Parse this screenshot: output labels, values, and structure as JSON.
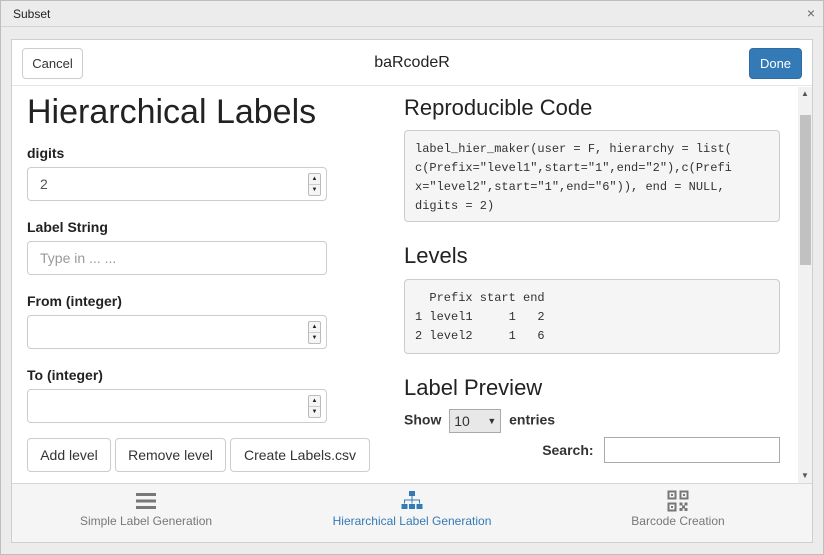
{
  "window": {
    "title": "Subset",
    "close": "×"
  },
  "header": {
    "cancel_label": "Cancel",
    "title": "baRcodeR",
    "done_label": "Done"
  },
  "form": {
    "heading": "Hierarchical Labels",
    "digits_label": "digits",
    "digits_value": "2",
    "label_string_label": "Label String",
    "label_string_placeholder": "Type in ... ...",
    "from_label": "From (integer)",
    "from_value": "",
    "to_label": "To (integer)",
    "to_value": "",
    "add_level": "Add level",
    "remove_level": "Remove level",
    "create_labels": "Create Labels.csv"
  },
  "output": {
    "code_heading": "Reproducible Code",
    "code": "label_hier_maker(user = F, hierarchy = list(\nc(Prefix=\"level1\",start=\"1\",end=\"2\"),c(Prefi\nx=\"level2\",start=\"1\",end=\"6\")), end = NULL,\ndigits = 2)",
    "levels_heading": "Levels",
    "levels": "  Prefix start end\n1 level1     1   2\n2 level2     1   6",
    "preview_heading": "Label Preview",
    "show_label": "Show",
    "entries_value": "10",
    "entries_label": "entries",
    "search_label": "Search:"
  },
  "nav": {
    "tabs": [
      {
        "label": "Simple Label Generation",
        "icon": "menu-lines-icon"
      },
      {
        "label": "Hierarchical Label Generation",
        "icon": "sitemap-icon"
      },
      {
        "label": "Barcode Creation",
        "icon": "qrcode-icon"
      }
    ],
    "active_color": "#337ab7",
    "inactive_color": "#777777"
  },
  "colors": {
    "primary": "#337ab7"
  }
}
